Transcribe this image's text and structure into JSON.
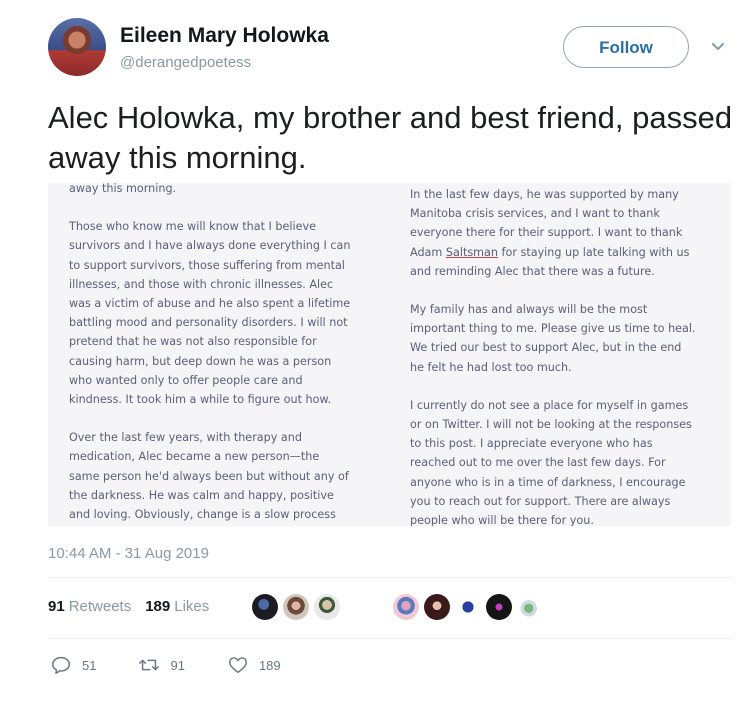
{
  "author": {
    "name": "Eileen Mary Holowka",
    "handle": "@derangedpoetess"
  },
  "follow_label": "Follow",
  "tweet_text": "Alec Holowka, my brother and best friend, passed away this morning.",
  "image_text": {
    "left": [
      "away this morning.",
      "Those who know me will know that I believe\nsurvivors and I have always done everything I can\nto support survivors, those suffering from mental\nillnesses, and those with chronic illnesses. Alec\nwas a victim of abuse and he also spent a lifetime\nbattling mood and personality disorders. I will not\npretend that he was not also responsible for\ncausing harm, but deep down he was a person\nwho wanted only to offer people care and\nkindness. It took him a while to figure out how.",
      "Over the last few years, with therapy and\nmedication, Alec became a new person—the\nsame person he'd always been but without any of\nthe darkness. He was calm and happy, positive\nand loving. Obviously, change is a slow process"
    ],
    "right": {
      "p1_before": "In the last few days, he was supported by many\nManitoba crisis services, and I want to thank\neveryone there for their support. I want to thank\nAdam ",
      "p1_name": "Saltsman",
      "p1_after": " for staying up late talking with us\nand reminding Alec that there was a future.",
      "p2": "My family has and always will be the most\nimportant thing to me. Please give us time to heal.\nWe tried our best to support Alec, but in the end\nhe felt he had lost too much.",
      "p3": "I currently do not see a place for myself in games\nor on Twitter. I will not be looking at the responses\nto this post. I appreciate everyone who has\nreached out to me over the last few days. For\nanyone who is in a time of darkness, I encourage\nyou to reach out for support. There are always\npeople who will be there for you."
    }
  },
  "timestamp": "10:44 AM - 31 Aug 2019",
  "stats": {
    "retweets_count": "91",
    "retweets_label": "Retweets",
    "likes_count": "189",
    "likes_label": "Likes"
  },
  "actions": {
    "replies": "51",
    "retweets": "91",
    "likes": "189"
  },
  "icons": {
    "reply": "reply-icon",
    "retweet": "retweet-icon",
    "like": "heart-icon",
    "more": "chevron-down-icon"
  },
  "colors": {
    "follow_text": "#2a6fa8",
    "muted": "#8899a6"
  }
}
